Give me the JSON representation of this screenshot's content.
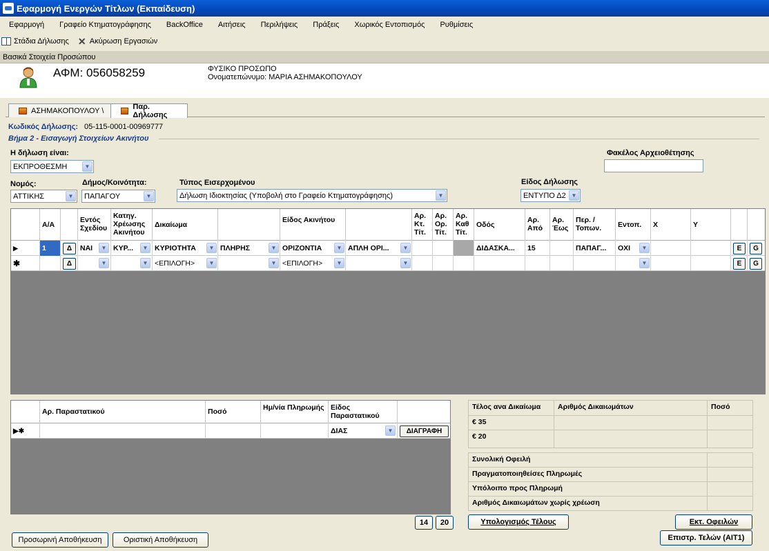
{
  "window": {
    "title": "Εφαρμογή Ενεργών Τίτλων (Εκπαίδευση)"
  },
  "menu": [
    "Εφαρμογή",
    "Γραφείο Κτηματογράφησης",
    "BackOffice",
    "Αιτήσεις",
    "Περιλήψεις",
    "Πράξεις",
    "Χωρικός Εντοπισμός",
    "Ρυθμίσεις"
  ],
  "toolbar": {
    "stages_label": "Στάδια Δήλωσης",
    "cancel_label": "Ακύρωση Εργασιών"
  },
  "section_title": "Βασικά Στοιχεία Προσώπου",
  "person": {
    "afm": "ΑΦΜ: 056058259",
    "type": "ΦΥΣΙΚΟ ΠΡΟΣΩΠΟ",
    "name": "Ονοματεπώνυμο: ΜΑΡΙΑ ΑΣΗΜΑΚΟΠΟΥΛΟΥ"
  },
  "tabs": [
    "ΑΣΗΜΑΚΟΠΟΥΛΟΥ \\",
    "Παρ. Δήλωσης"
  ],
  "declaration": {
    "code_label": "Κωδικός Δήλωσης:",
    "code": "05-115-0001-00969777",
    "step_title": "Βήμα 2 - Εισαγωγή Στοιχείων Ακινήτου"
  },
  "form": {
    "timing_label": "Η δήλωση είναι:",
    "timing_value": "ΕΚΠΡΟΘΕΣΜΗ",
    "folder_label": "Φακέλος Αρχειοθέτησης",
    "folder_value": "",
    "prefecture_label": "Νομός:",
    "prefecture_value": "ΑΤΤΙΚΗΣ",
    "municipality_label": "Δήμος/Κοινότητα:",
    "municipality_value": "ΠΑΠΑΓΟΥ",
    "income_label": "Τύπος Εισερχομένου",
    "income_value": "Δήλωση Ιδιοκτησίας  (Υποβολή στο Γραφείο Κτηματογράφησης)",
    "decltype_label": "Είδος Δήλωσης",
    "decltype_value": "ΕΝΤΥΠΟ Δ2"
  },
  "property_grid": {
    "headers": [
      "Α/Α",
      "Εντός Σχεδίου",
      "Κατηγ. Χρέωσης Ακινήτου",
      "Δικαίωμα",
      "Είδος Ακινήτου",
      "Αρ. Κτ. Τίτ.",
      "Αρ. Ορ. Τίτ.",
      "Αρ. Καθ Τίτ.",
      "Οδός",
      "Αρ. Από",
      "Αρ. Έως",
      "Περ. / Τοπων.",
      "Εντοπ.",
      "X",
      "Y"
    ],
    "row1": {
      "aa": "1",
      "d_btn": "Δ",
      "entos": "ΝΑΙ",
      "kateg": "ΚΥΡ...",
      "dikaioma": "ΚΥΡΙΟΤΗΤΑ",
      "dik2": "ΠΛΗΡΗΣ",
      "eidos": "ΟΡΙΖΟΝΤΙΑ",
      "eidos2": "ΑΠΛΗ ΟΡΙ...",
      "odos": "ΔΙΔΑΣΚΑ...",
      "apo": "15",
      "perioxi": "ΠΑΠΑΓ...",
      "entop": "ΟΧΙ",
      "e_btn": "E",
      "g_btn": "G"
    },
    "row2": {
      "d_btn": "Δ",
      "dikaioma": "<ΕΠΙΛΟΓΗ>",
      "eidos": "<ΕΠΙΛΟΓΗ>",
      "e_btn": "E",
      "g_btn": "G"
    }
  },
  "payment_grid": {
    "headers": [
      "Αρ. Παραστατικού",
      "Ποσό",
      "Ημ/νία Πληρωμής",
      "Είδος Παραστατικού"
    ],
    "new_row_type": "ΔΙΑΣ",
    "delete_label": "ΔΙΑΓΡΑΦΗ"
  },
  "fees": {
    "headers": [
      "Τέλος ανα Δικαίωμα",
      "Αριθμός Δικαιωμάτων",
      "Ποσό"
    ],
    "rows": [
      "€ 35",
      "€ 20"
    ],
    "summary": [
      "Συνολική Οφειλή",
      "Πραγματοποιηθείσες Πληρωμές",
      "Υπόλοιπο προς Πληρωμή",
      "Αριθμός Δικαιωμάτων χωρίς χρέωση"
    ]
  },
  "buttons": {
    "b14": "14",
    "b20": "20",
    "calc": "Υπολογισμός Τέλους",
    "ext": "Εκτ. Οφειλών",
    "refund": "Επιστρ. Τελών (ΑΙΤ1)",
    "temp_save": "Προσωρινή Αποθήκευση",
    "final_save": "Οριστική Αποθήκευση"
  }
}
